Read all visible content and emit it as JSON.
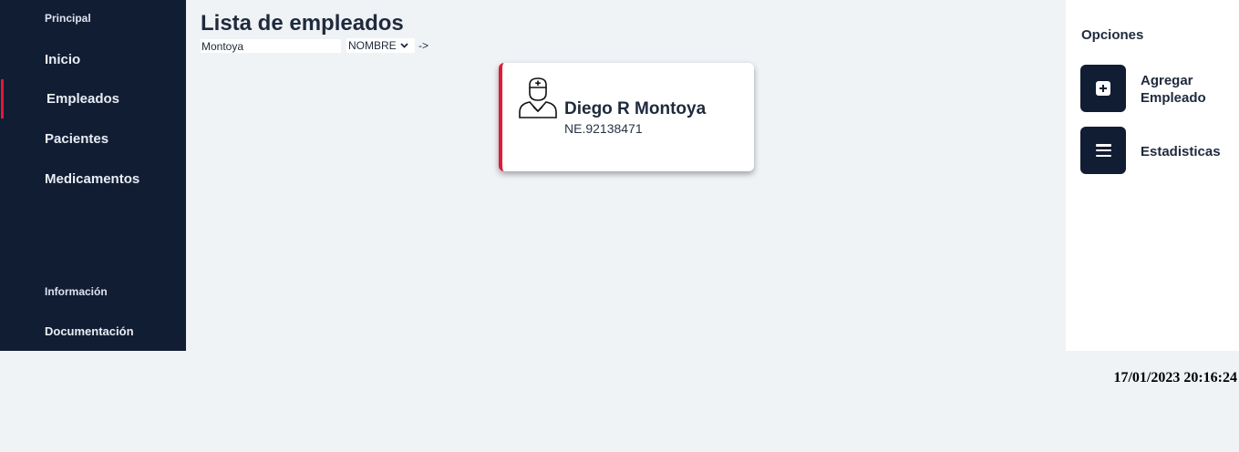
{
  "sidebar": {
    "section_principal": "Principal",
    "items": [
      {
        "label": "Inicio"
      },
      {
        "label": "Empleados"
      },
      {
        "label": "Pacientes"
      },
      {
        "label": "Medicamentos"
      }
    ],
    "section_info": "Información",
    "doc_label": "Documentación",
    "active_item": "Empleados",
    "accent_color": "#e11a35",
    "bg_color": "#111d33"
  },
  "main": {
    "title": "Lista de empleados",
    "search": {
      "value": "Montoya",
      "placeholder": ""
    },
    "filter": {
      "selected": "NOMBRE",
      "icon": "chevron-down-icon"
    },
    "go_label": "->"
  },
  "employees": [
    {
      "name": "Diego R Montoya",
      "code": "NE.92138471",
      "icon": "doctor-icon"
    }
  ],
  "options": {
    "title": "Opciones",
    "add_label_1": "Agregar",
    "add_label_2": "Empleado",
    "add_icon": "plus-square-icon",
    "stats_label": "Estadisticas",
    "stats_icon": "menu-icon"
  },
  "footer": {
    "timestamp": "17/01/2023 20:16:24"
  }
}
